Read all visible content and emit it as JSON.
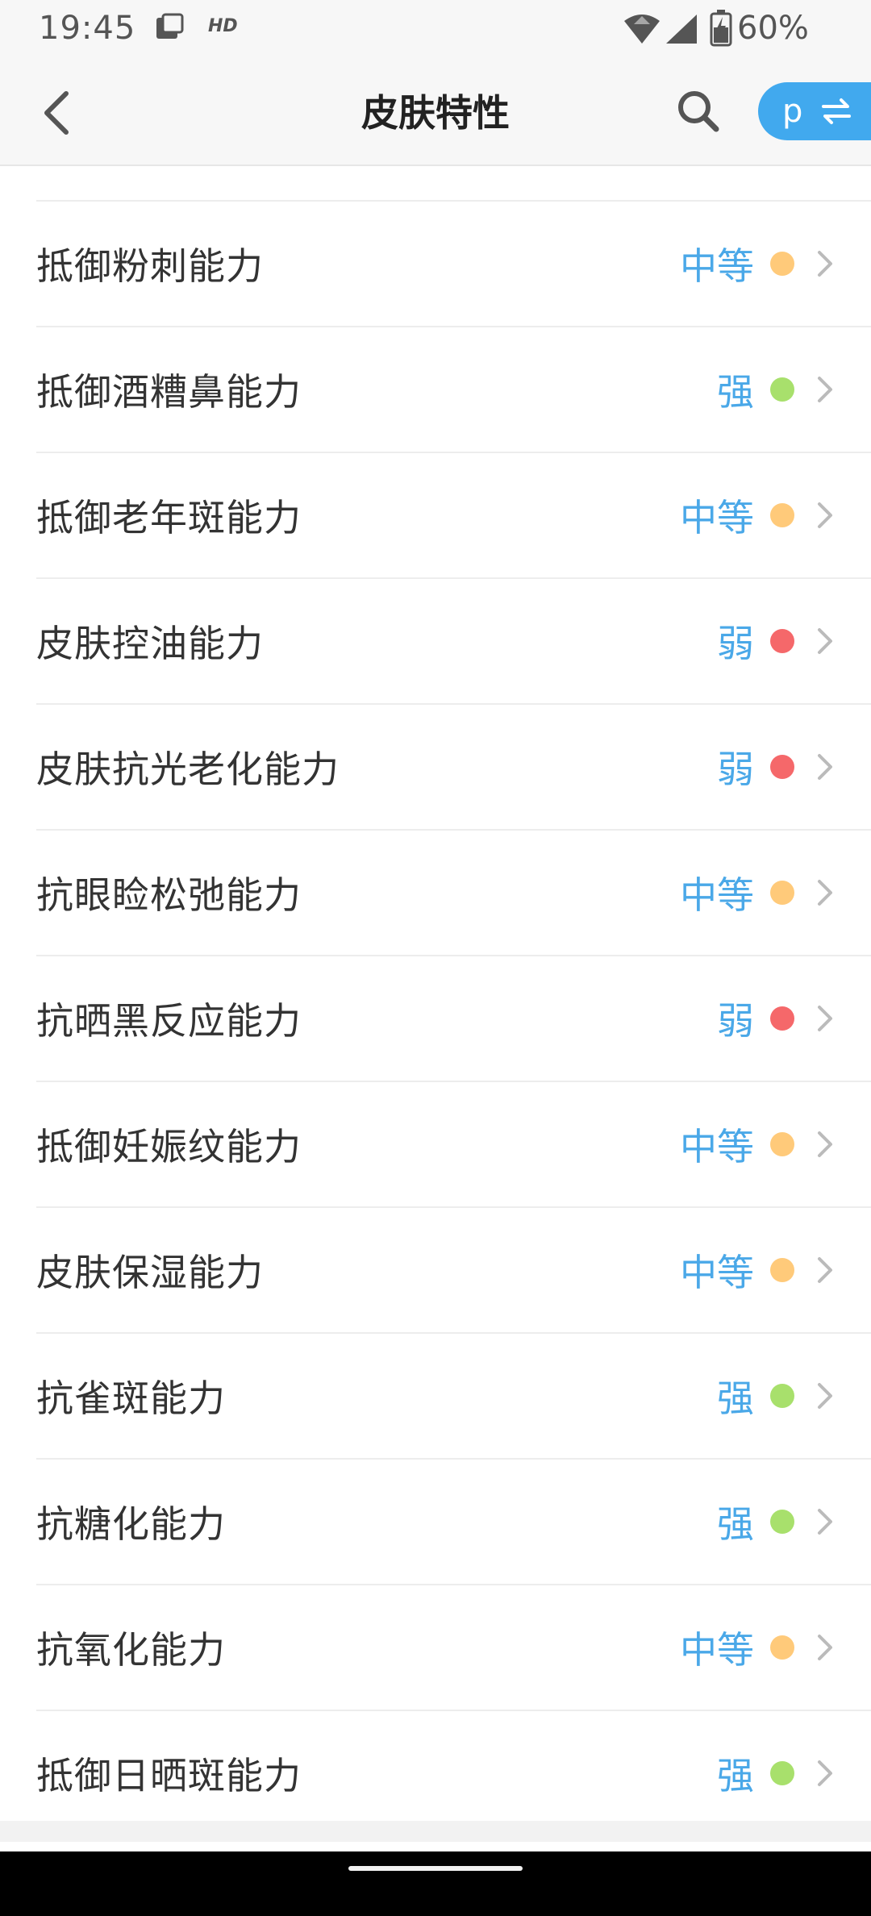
{
  "status_bar": {
    "time": "19:45",
    "hd_label": "HD",
    "battery_percent": "60%"
  },
  "header": {
    "title": "皮肤特性",
    "switch_letter": "p"
  },
  "colors": {
    "value_text": "#4aa8e8",
    "medium": "#ffca7a",
    "strong": "#a8e06c",
    "weak": "#f5686a",
    "pill": "#41a9ee"
  },
  "rows": [
    {
      "label": "抵御粉刺能力",
      "value": "中等",
      "level": "medium"
    },
    {
      "label": "抵御酒糟鼻能力",
      "value": "强",
      "level": "strong"
    },
    {
      "label": "抵御老年斑能力",
      "value": "中等",
      "level": "medium"
    },
    {
      "label": "皮肤控油能力",
      "value": "弱",
      "level": "weak"
    },
    {
      "label": "皮肤抗光老化能力",
      "value": "弱",
      "level": "weak"
    },
    {
      "label": "抗眼睑松弛能力",
      "value": "中等",
      "level": "medium"
    },
    {
      "label": "抗晒黑反应能力",
      "value": "弱",
      "level": "weak"
    },
    {
      "label": "抵御妊娠纹能力",
      "value": "中等",
      "level": "medium"
    },
    {
      "label": "皮肤保湿能力",
      "value": "中等",
      "level": "medium"
    },
    {
      "label": "抗雀斑能力",
      "value": "强",
      "level": "strong"
    },
    {
      "label": "抗糖化能力",
      "value": "强",
      "level": "strong"
    },
    {
      "label": "抗氧化能力",
      "value": "中等",
      "level": "medium"
    },
    {
      "label": "抵御日晒斑能力",
      "value": "强",
      "level": "strong"
    }
  ]
}
